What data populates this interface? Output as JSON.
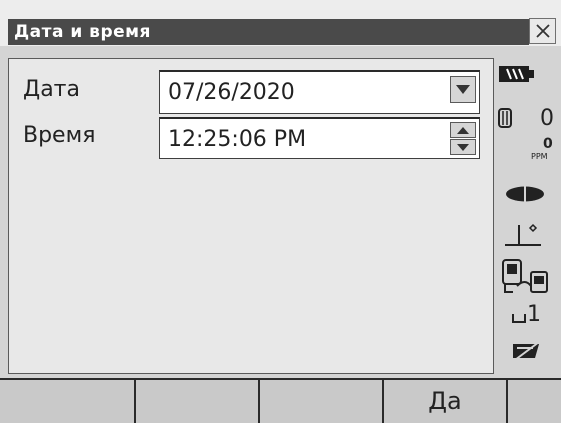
{
  "window": {
    "title": "Дата и время"
  },
  "form": {
    "date_label": "Дата",
    "date_value": "07/26/2020",
    "time_label": "Время",
    "time_value": "12:25:06 PM"
  },
  "status": {
    "battery_icon": "battery-icon",
    "prism_constant_value": "0",
    "ppm_value": "0",
    "ppm_unit": "PPM",
    "target_icon": "reflector-target-icon",
    "tilt_icon": "tilt-compensation-icon",
    "comm_icon": "communication-icon",
    "input_mode_value": "1",
    "memory_icon": "memory-card-icon"
  },
  "softkeys": {
    "f1": "",
    "f2": "",
    "f3": "",
    "f4": "Да",
    "f5": ""
  },
  "colors": {
    "title_bar": "#4a4a4a",
    "background": "#d4d4d4",
    "field_bg": "#ffffff",
    "softkey_bg": "#c9c9c9"
  }
}
